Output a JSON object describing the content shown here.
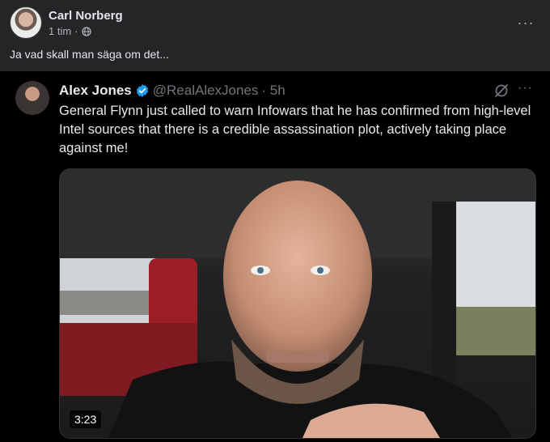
{
  "post": {
    "author": "Carl Norberg",
    "time": "1 tim",
    "separator": "·",
    "text": "Ja vad skall man säga om det...",
    "more": "···"
  },
  "tweet": {
    "name": "Alex Jones",
    "handle": "@RealAlexJones",
    "time": "· 5h",
    "text": "General Flynn just called to warn Infowars that he has confirmed from high-level Intel sources that there is a credible assassination plot, actively taking place against me!",
    "more": "···",
    "video": {
      "duration": "3:23"
    }
  },
  "colors": {
    "verified": "#1d9bf0",
    "fb_bg": "#242526",
    "tw_bg": "#000000"
  },
  "icons": [
    "globe-icon",
    "more-icon",
    "verified-icon",
    "grok-icon"
  ]
}
